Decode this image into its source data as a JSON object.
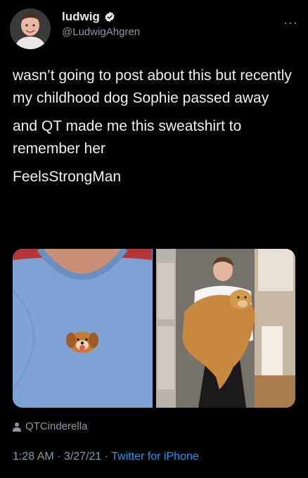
{
  "author": {
    "display_name": "ludwig",
    "handle": "@LudwigAhgren"
  },
  "tweet": {
    "paragraphs": [
      "wasn’t going to post about this but recently my childhood dog Sophie passed away",
      "and QT made me this sweatshirt to remember her",
      "FeelsStrongMan"
    ]
  },
  "tagged_user": "QTCinderella",
  "meta": {
    "time": "1:28 AM",
    "date": "3/27/21",
    "separator": "·",
    "source": "Twitter for iPhone"
  },
  "icons": {
    "verified": "verified-badge-icon",
    "more": "more-options-icon",
    "tag": "person-tag-icon"
  },
  "colors": {
    "background": "#000000",
    "text": "#e7e9ea",
    "secondary": "#8b98a5",
    "link": "#1d9bf0"
  }
}
